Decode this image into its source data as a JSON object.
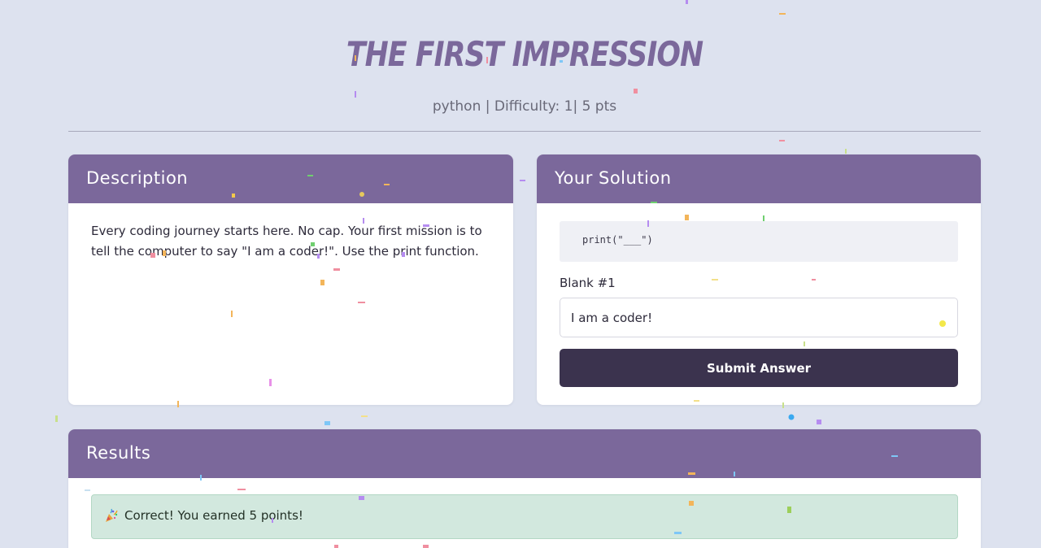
{
  "challenge": {
    "title": "The First Impression",
    "language": "python",
    "difficulty_label": "Difficulty:",
    "difficulty": "1",
    "points": "5 pts",
    "separator": "|"
  },
  "description": {
    "heading": "Description",
    "text": "Every coding journey starts here. No cap. Your first mission is to tell the computer to say \"I am a coder!\". Use the print function."
  },
  "solution": {
    "heading": "Your Solution",
    "code": "print(\"___\")",
    "blank_label": "Blank #1",
    "blank_value": "I am a coder!",
    "submit_label": "Submit Answer"
  },
  "results": {
    "heading": "Results",
    "message": "Correct! You earned 5 points!",
    "icon": "party-popper-icon"
  },
  "colors": {
    "accent": "#7b689b",
    "background": "#dde2ef",
    "button": "#3b334e",
    "success_bg": "#d2e8de"
  }
}
